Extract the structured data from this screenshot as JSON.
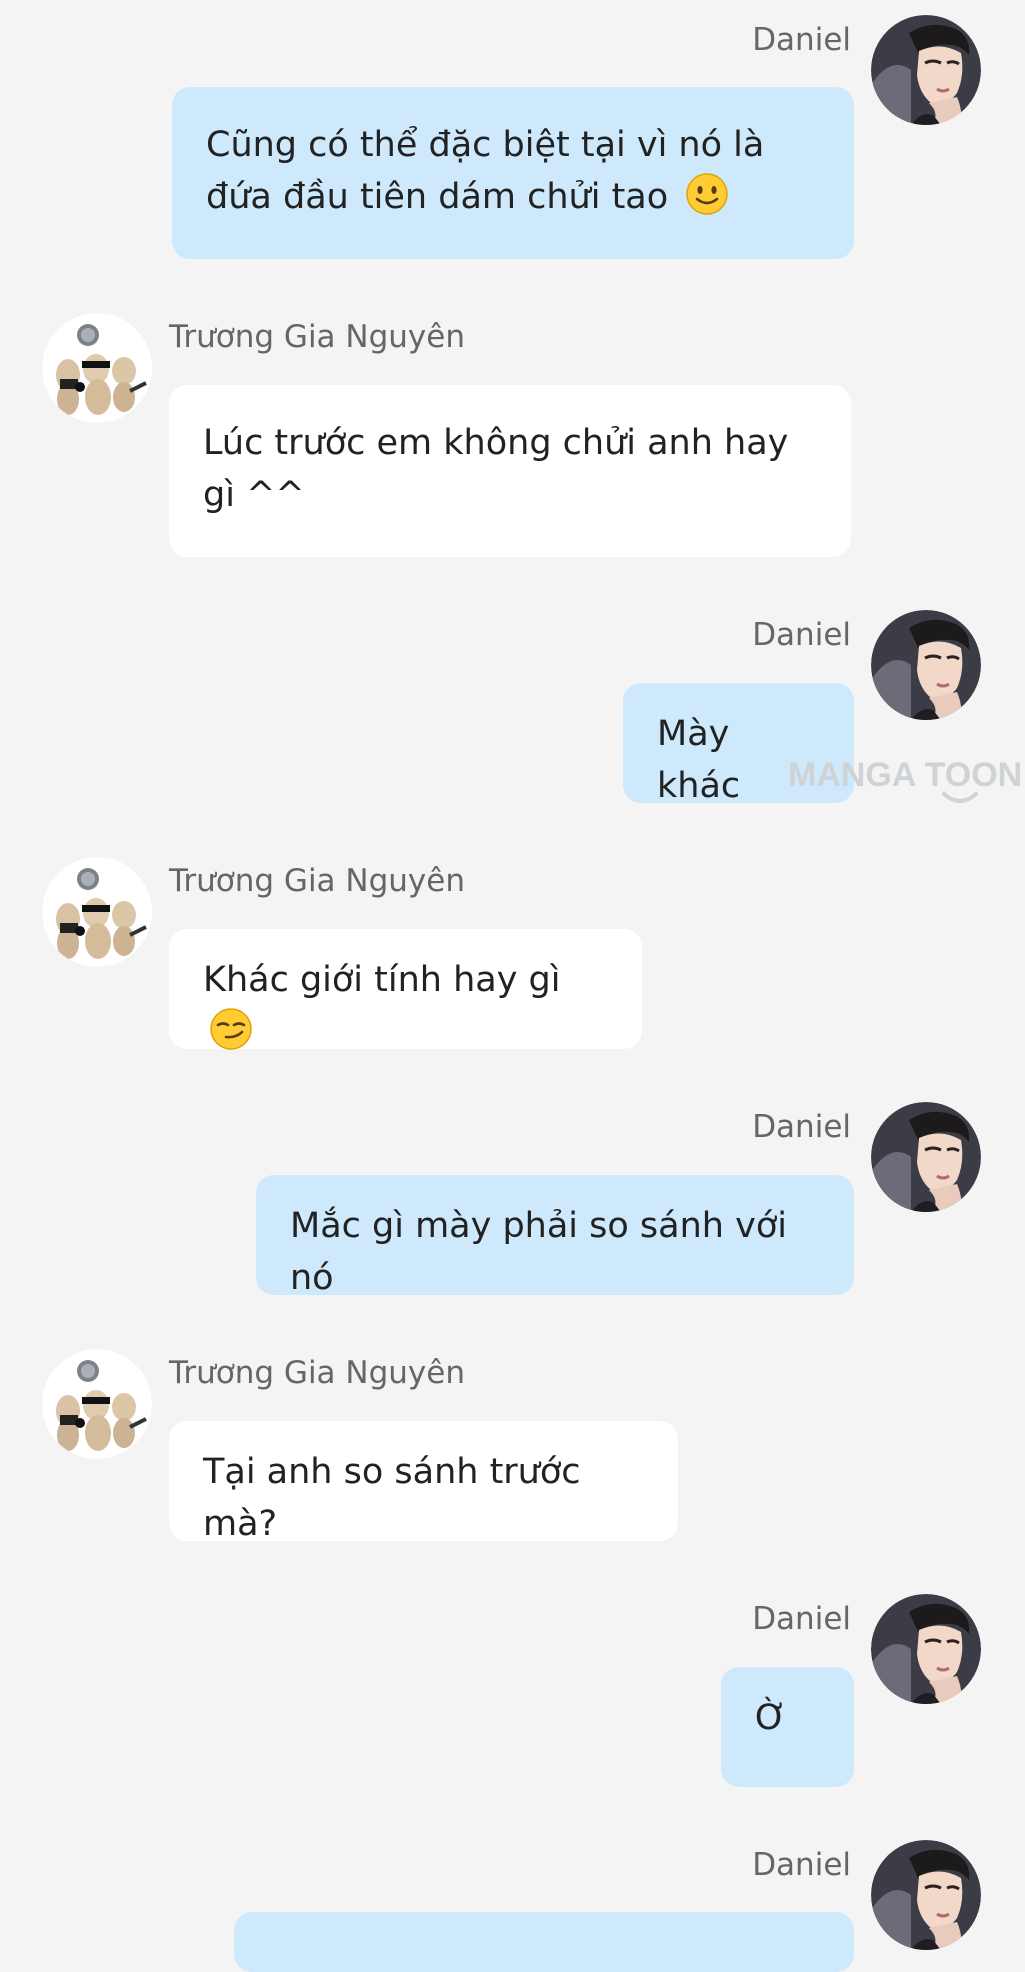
{
  "conversation": {
    "messages": [
      {
        "sender": "Daniel",
        "side": "right",
        "text": "Cũng có thể đặc biệt tại vì nó là đứa đầu tiên dám chửi tao",
        "emoji": "slightly-smiling-face"
      },
      {
        "sender": "Trương Gia Nguyên",
        "side": "left",
        "text": "Lúc trước em không chửi anh hay gì ^^"
      },
      {
        "sender": "Daniel",
        "side": "right",
        "text": "Mày khác"
      },
      {
        "sender": "Trương Gia Nguyên",
        "side": "left",
        "text": "Khác giới tính hay gì",
        "emoji": "smirking-face"
      },
      {
        "sender": "Daniel",
        "side": "right",
        "text": "Mắc gì mày phải so sánh với nó"
      },
      {
        "sender": "Trương Gia Nguyên",
        "side": "left",
        "text": "Tại anh so sánh trước mà?"
      },
      {
        "sender": "Daniel",
        "side": "right",
        "text": "Ờ"
      },
      {
        "sender": "Daniel",
        "side": "right",
        "text": ""
      }
    ]
  },
  "watermark": {
    "text": "MANGA TOON"
  },
  "colors": {
    "background": "#f4f4f4",
    "outgoing_bubble": "#cde9fb",
    "incoming_bubble": "#ffffff",
    "name_text": "#666666",
    "message_text": "#222222"
  },
  "icons": {
    "daniel_avatar": "daniel-avatar",
    "nguyen_avatar": "cats-group-avatar",
    "emoji_1": "slightly-smiling-face-icon",
    "emoji_2": "smirking-face-icon"
  }
}
